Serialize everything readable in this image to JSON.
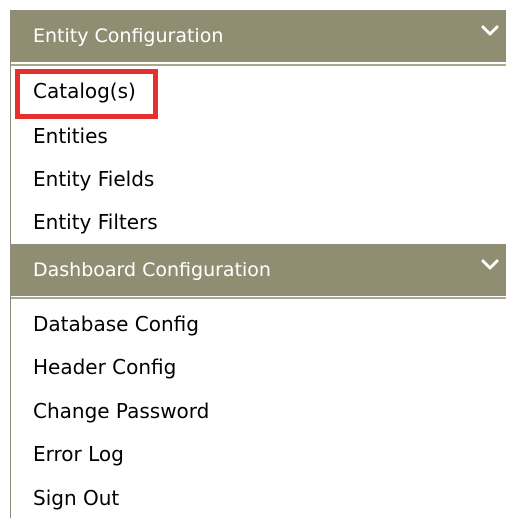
{
  "sections": [
    {
      "title": "Entity Configuration",
      "icon": "chevron-down-icon",
      "items": [
        "Catalog(s)",
        "Entities",
        "Entity Fields",
        "Entity Filters"
      ]
    },
    {
      "title": "Dashboard Configuration",
      "icon": "chevron-down-icon",
      "items": [
        "Database Config",
        "Header Config",
        "Change Password",
        "Error Log",
        "Sign Out"
      ]
    }
  ],
  "highlighted_item": "Catalog(s)",
  "colors": {
    "header_bg": "#8f8e73",
    "header_text": "#ffffff",
    "highlight": "#e5302f"
  }
}
